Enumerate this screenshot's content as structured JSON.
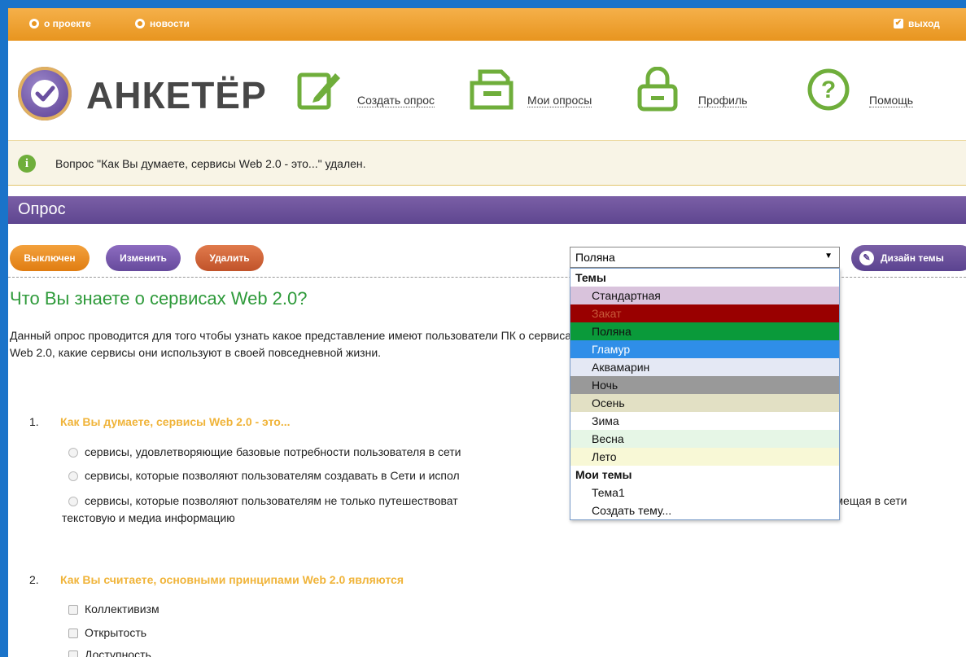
{
  "topbar": {
    "about": "о проекте",
    "news": "новости",
    "logout": "выход"
  },
  "header": {
    "logo": "АНКЕТЁР",
    "nav": [
      {
        "label": "Создать опрос",
        "icon": "pencil-note-icon"
      },
      {
        "label": "Мои опросы",
        "icon": "folder-icon"
      },
      {
        "label": "Профиль",
        "icon": "lock-icon"
      },
      {
        "label": "Помощь",
        "icon": "question-icon"
      }
    ]
  },
  "notice": {
    "message": "Вопрос \"Как Вы думаете, сервисы Web 2.0 - это...\" удален."
  },
  "section": {
    "title": "Опрос"
  },
  "actions": {
    "disabled": "Выключен",
    "edit": "Изменить",
    "delete": "Удалить",
    "design": "Дизайн темы"
  },
  "theme_select": {
    "value": "Поляна",
    "groups": [
      {
        "label": "Темы",
        "items": [
          {
            "label": "Стандартная",
            "bg": "#d9c3dc",
            "fg": "#111111"
          },
          {
            "label": "Закат",
            "bg": "#990000",
            "fg": "#c85a3a"
          },
          {
            "label": "Поляна",
            "bg": "#0a9a3a",
            "fg": "#111111"
          },
          {
            "label": "Гламур",
            "bg": "#2f8ee8",
            "fg": "#ffffff"
          },
          {
            "label": "Аквамарин",
            "bg": "#e4e8f4",
            "fg": "#111111"
          },
          {
            "label": "Ночь",
            "bg": "#999999",
            "fg": "#111111"
          },
          {
            "label": "Осень",
            "bg": "#e2e0c4",
            "fg": "#111111"
          },
          {
            "label": "Зима",
            "bg": "#ffffff",
            "fg": "#111111"
          },
          {
            "label": "Весна",
            "bg": "#e6f6e6",
            "fg": "#111111"
          },
          {
            "label": "Лето",
            "bg": "#f8f8d6",
            "fg": "#111111"
          }
        ]
      },
      {
        "label": "Мои темы",
        "items": [
          {
            "label": "Тема1",
            "bg": "#ffffff",
            "fg": "#111111"
          },
          {
            "label": "Создать тему...",
            "bg": "#ffffff",
            "fg": "#111111"
          }
        ]
      }
    ]
  },
  "survey": {
    "title": "Что Вы знаете о сервисах Web 2.0?",
    "description": "Данный опрос проводится для того чтобы узнать какое представление имеют пользователи ПК о сервисах Web 2.0, какие сервисы они используют в своей повседневной жизни.",
    "q1": {
      "num": "1.",
      "text": "Как Вы думаете, сервисы Web 2.0 - это...",
      "options": [
        "сервисы, удовлетворяющие базовые потребности пользователя в сети",
        "сервисы, которые позволяют пользователям создавать в Сети и испол",
        "сервисы, которые позволяют пользователям не только путешествоват"
      ],
      "option3_tail": "змещая в сети",
      "option3_line2": "текстовую и медиа информацию"
    },
    "q2": {
      "num": "2.",
      "text": "Как Вы считаете, основными принципами Web 2.0 являются",
      "options": [
        "Коллективизм",
        "Открытость",
        "Доступность"
      ]
    }
  }
}
